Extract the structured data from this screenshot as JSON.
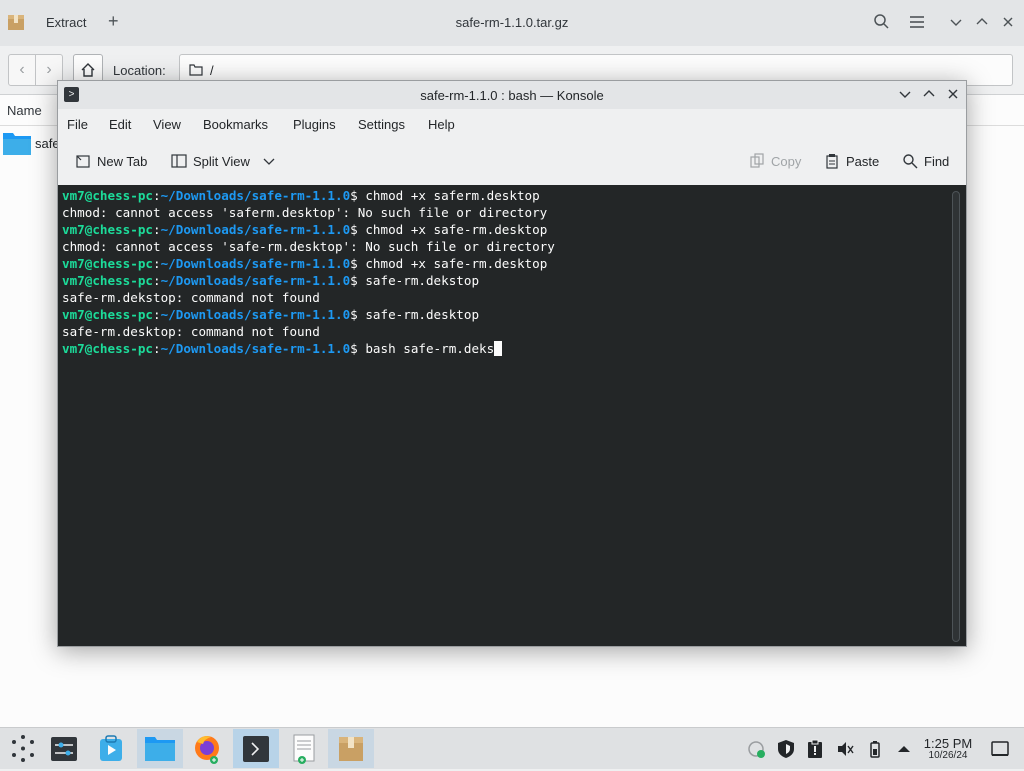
{
  "ark": {
    "title": "safe-rm-1.1.0.tar.gz",
    "extract_label": "Extract",
    "location_label": "Location:",
    "location_value": "/",
    "column_name": "Name",
    "file_item": "safe",
    "icons": [
      "package-icon",
      "plus-icon",
      "search-icon",
      "hamburger-menu-icon",
      "minimize-icon",
      "maximize-icon",
      "close-icon",
      "back-icon",
      "forward-icon",
      "home-icon",
      "folder-icon"
    ]
  },
  "konsole": {
    "title": "safe-rm-1.1.0 : bash — Konsole",
    "menu": [
      "File",
      "Edit",
      "View",
      "Bookmarks",
      "Plugins",
      "Settings",
      "Help"
    ],
    "toolbar": {
      "new_tab": "New Tab",
      "split_view": "Split View",
      "copy": "Copy",
      "paste": "Paste",
      "find": "Find"
    },
    "terminal": {
      "user_host": "vm7@chess-pc",
      "path": "~/Downloads/safe-rm-1.1.0",
      "lines": [
        {
          "type": "cmd",
          "text": "chmod +x saferm.desktop"
        },
        {
          "type": "out",
          "text": "chmod: cannot access 'saferm.desktop': No such file or directory"
        },
        {
          "type": "cmd",
          "text": "chmod +x safe-rm.desktop"
        },
        {
          "type": "out",
          "text": "chmod: cannot access 'safe-rm.desktop': No such file or directory"
        },
        {
          "type": "cmd",
          "text": "chmod +x safe-rm.desktop"
        },
        {
          "type": "cmd",
          "text": "safe-rm.dekstop"
        },
        {
          "type": "out",
          "text": "safe-rm.dekstop: command not found"
        },
        {
          "type": "cmd",
          "text": "safe-rm.desktop"
        },
        {
          "type": "out",
          "text": "safe-rm.desktop: command not found"
        },
        {
          "type": "cmd",
          "text": "bash safe-rm.deks",
          "cursor": true
        }
      ]
    }
  },
  "taskbar": {
    "time": "1:25 PM",
    "date": "10/26/24",
    "apps": [
      "app-launcher",
      "system-settings",
      "discover",
      "dolphin-file-manager",
      "firefox",
      "konsole",
      "kwrite",
      "ark"
    ]
  },
  "colors": {
    "terminal_bg": "#232627",
    "user_host": "#1cdc9a",
    "path": "#1d99f3",
    "accent": "#3daee9"
  }
}
